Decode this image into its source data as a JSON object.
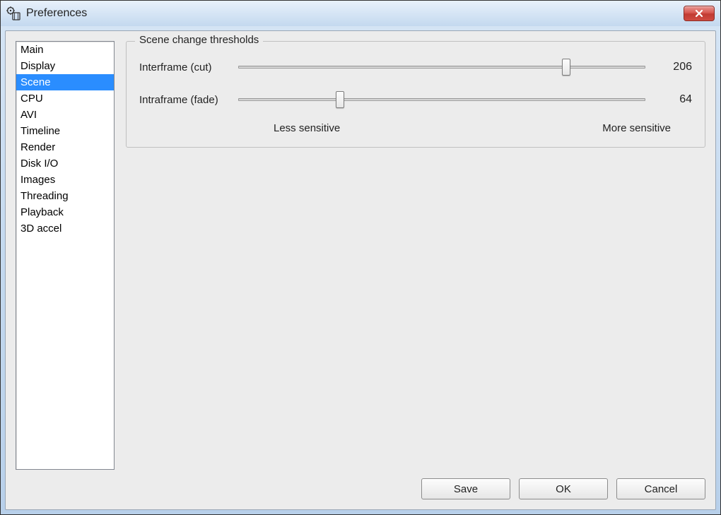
{
  "window": {
    "title": "Preferences"
  },
  "sidebar": {
    "items": [
      {
        "label": "Main"
      },
      {
        "label": "Display"
      },
      {
        "label": "Scene",
        "selected": true
      },
      {
        "label": "CPU"
      },
      {
        "label": "AVI"
      },
      {
        "label": "Timeline"
      },
      {
        "label": "Render"
      },
      {
        "label": "Disk I/O"
      },
      {
        "label": "Images"
      },
      {
        "label": "Threading"
      },
      {
        "label": "Playback"
      },
      {
        "label": "3D accel"
      }
    ]
  },
  "group": {
    "title": "Scene change thresholds",
    "sliders": [
      {
        "label": "Interframe (cut)",
        "value": 206,
        "max": 256
      },
      {
        "label": "Intraframe (fade)",
        "value": 64,
        "max": 256
      }
    ],
    "hints": {
      "left": "Less sensitive",
      "right": "More sensitive"
    }
  },
  "buttons": {
    "save": "Save",
    "ok": "OK",
    "cancel": "Cancel"
  }
}
